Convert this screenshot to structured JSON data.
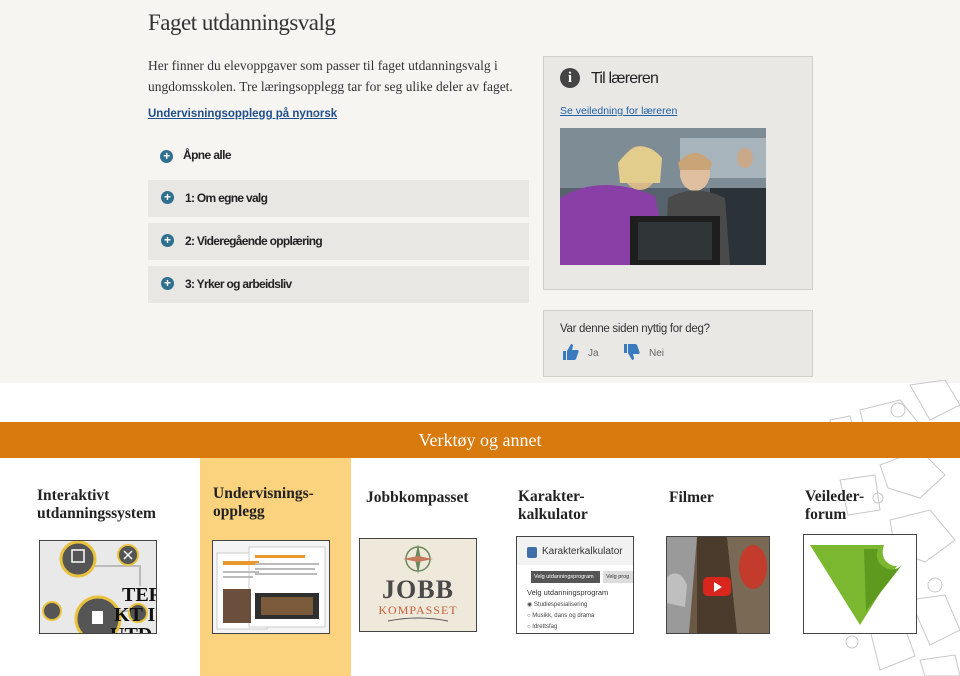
{
  "page": {
    "title": "Faget utdanningsvalg",
    "intro": "Her finner du elevoppgaver som passer til faget utdanningsvalg i ungdomsskolen. Tre læringsopplegg tar for seg ulike deler av faget.",
    "nynorsk_link": "Undervisningsopplegg på nynorsk",
    "open_all": "Åpne alle",
    "accordion": [
      {
        "label": "1: Om egne valg"
      },
      {
        "label": "2: Videregående opplæring"
      },
      {
        "label": "3: Yrker og arbeidsliv"
      }
    ]
  },
  "teacher_panel": {
    "title": "Til læreren",
    "link": "Se veiledning for læreren"
  },
  "feedback": {
    "question": "Var denne siden nyttig for deg?",
    "yes": "Ja",
    "no": "Nei"
  },
  "tools": {
    "header": "Verktøy og annet",
    "items": [
      {
        "line1": "Interaktivt",
        "line2": "utdanningssystem"
      },
      {
        "line1": "Undervisnings-",
        "line2": "opplegg"
      },
      {
        "line1": "Jobbkompasset",
        "line2": ""
      },
      {
        "line1": "Karakter-",
        "line2": "kalkulator"
      },
      {
        "line1": "Filmer",
        "line2": ""
      },
      {
        "line1": "Veileder-",
        "line2": "forum"
      }
    ],
    "thumbs": {
      "interaktivt_overlay": [
        "TER",
        "KT I",
        "UTDANNI"
      ],
      "jobb_logo": [
        "JOBB",
        "KOMPASSET"
      ],
      "kalk_title": "Karakterkalkulator",
      "kalk_tab1": "Velg utdanningsprogram",
      "kalk_tab2": "Velg prog",
      "kalk_heading": "Velg utdanningsprogram",
      "kalk_options": [
        "Studiespesialisering",
        "Musikk, dans og drama",
        "Idrettsfag"
      ]
    }
  },
  "colors": {
    "accent_orange": "#d97a0e",
    "highlight": "#fbd27e",
    "link_blue": "#1f5fa6",
    "plus_icon": "#2f6f8f",
    "logo_green": "#7cb82f"
  }
}
